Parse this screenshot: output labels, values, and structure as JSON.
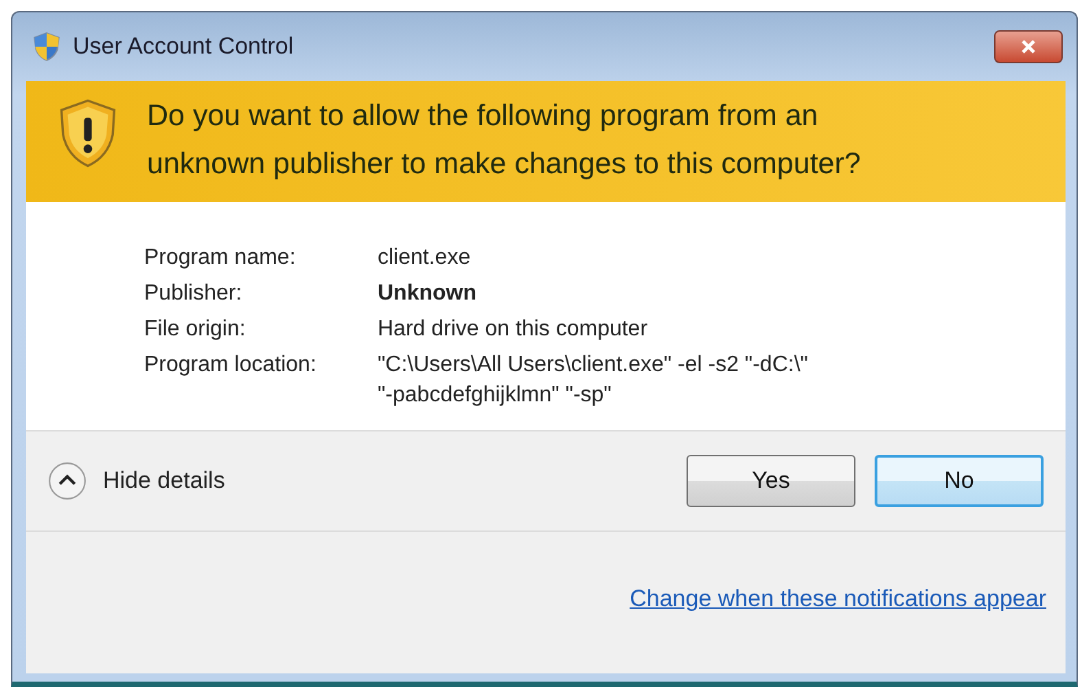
{
  "window": {
    "title": "User Account Control"
  },
  "header": {
    "question": "Do you want to allow the following program from an\nunknown publisher to make changes to this computer?"
  },
  "details": [
    {
      "label": "Program name:",
      "value": "client.exe",
      "bold": false
    },
    {
      "label": "Publisher:",
      "value": "Unknown",
      "bold": true
    },
    {
      "label": "File origin:",
      "value": "Hard drive on this computer",
      "bold": false
    },
    {
      "label": "Program location:",
      "value": "\"C:\\Users\\All Users\\client.exe\" -el -s2 \"-dC:\\\"\n\"-pabcdefghijklmn\" \"-sp\"",
      "bold": false
    }
  ],
  "toggle": {
    "label": "Hide details",
    "expanded": true
  },
  "buttons": [
    {
      "label": "Yes",
      "selected": false
    },
    {
      "label": "No",
      "selected": true
    }
  ],
  "link": "Change when these notifications appear"
}
